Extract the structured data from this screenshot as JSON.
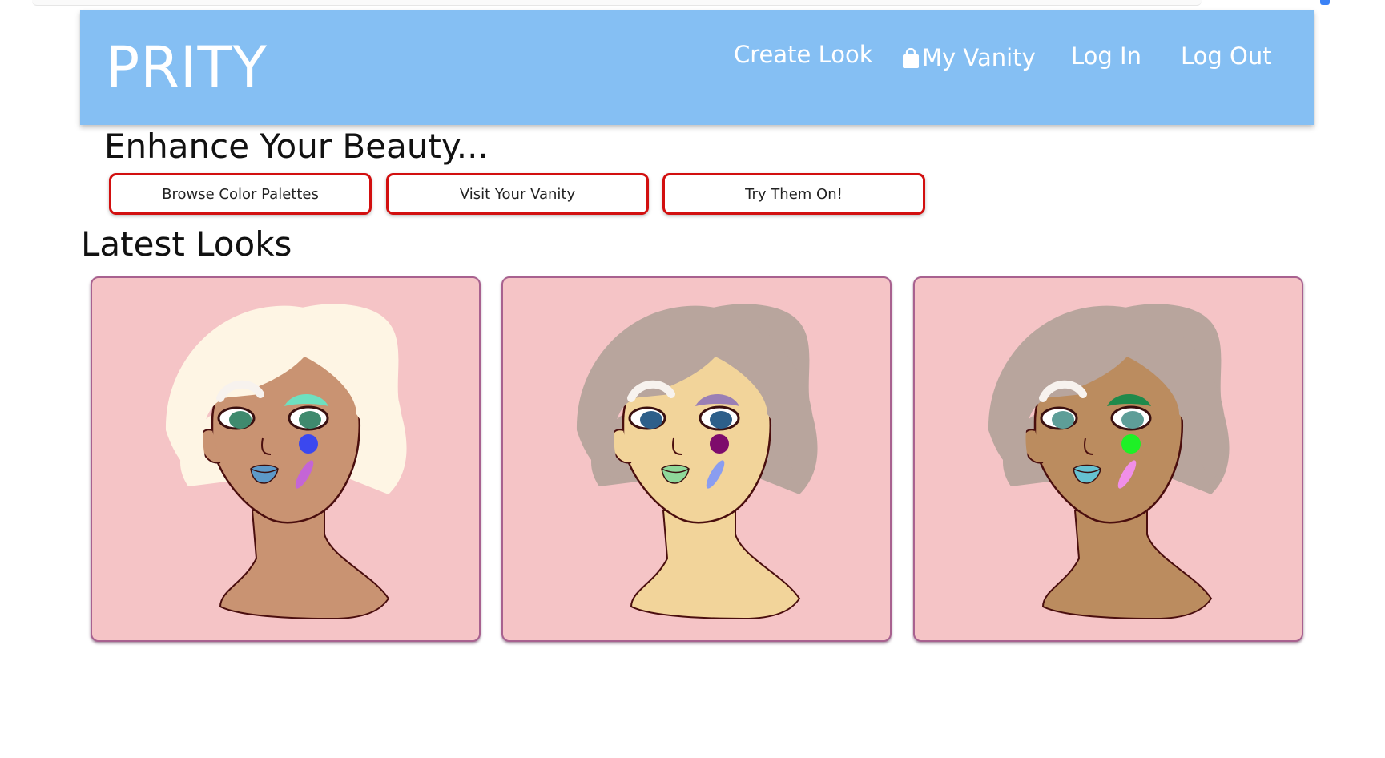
{
  "navbar": {
    "brand": "PRITY",
    "links": [
      {
        "label": "Create Look"
      },
      {
        "label": "My Vanity",
        "icon": "shopping-bag-icon"
      },
      {
        "label": "Log In"
      },
      {
        "label": "Log Out"
      }
    ],
    "background": "#85bff3"
  },
  "hero": {
    "headline": "Enhance Your Beauty...",
    "buttons": [
      {
        "label": "Browse Color Palettes"
      },
      {
        "label": "Visit Your Vanity"
      },
      {
        "label": "Try Them On!"
      }
    ],
    "button_border_color": "#d20f0f"
  },
  "latest": {
    "title": "Latest Looks",
    "looks": [
      {
        "hair": "#fef5e4",
        "skin": "#c99372",
        "eyeshadow": "#6ee0c0",
        "iris": "#3f8a6e",
        "lips": "#5d99c8",
        "blush_dot": "#3b48ef",
        "blush_stripe": "#c465d6"
      },
      {
        "hair": "#b8a59d",
        "skin": "#f2d49a",
        "eyeshadow": "#9a7fb5",
        "iris": "#2d5f8a",
        "lips": "#8fd89a",
        "blush_dot": "#7e0c6c",
        "blush_stripe": "#8a9df0"
      },
      {
        "hair": "#b8a59d",
        "skin": "#bb8c5f",
        "eyeshadow": "#1f8a4b",
        "iris": "#5e9e98",
        "lips": "#66c2d1",
        "blush_dot": "#1ef026",
        "blush_stripe": "#f08fe8"
      }
    ],
    "card_background": "#f5c4c6"
  }
}
